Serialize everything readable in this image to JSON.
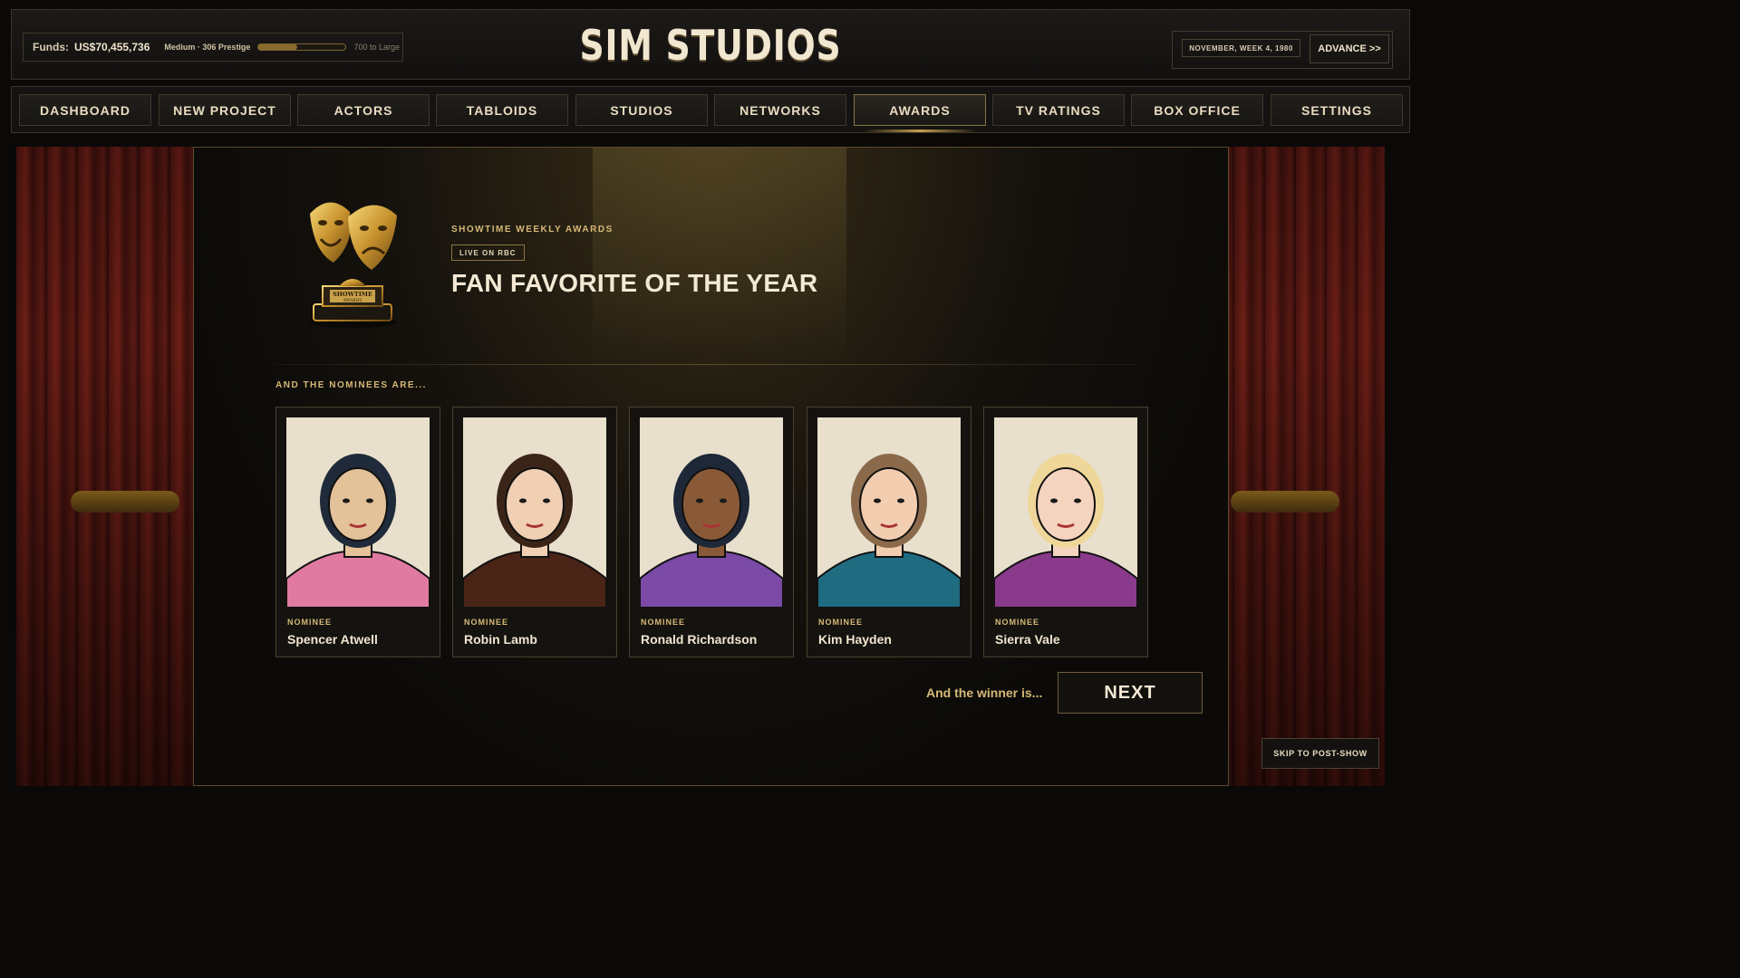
{
  "header": {
    "funds_label": "Funds:",
    "funds_value": "US$70,455,736",
    "studio_tier": "Medium · 306 Prestige",
    "tier_progress": 0.44,
    "next_tier": "700 to Large",
    "logo": "SIM STUDIOS",
    "date": "NOVEMBER, WEEK 4, 1980",
    "advance_label": "ADVANCE >>"
  },
  "nav": {
    "tabs": [
      {
        "label": "DASHBOARD"
      },
      {
        "label": "NEW PROJECT"
      },
      {
        "label": "ACTORS"
      },
      {
        "label": "TABLOIDS"
      },
      {
        "label": "STUDIOS"
      },
      {
        "label": "NETWORKS"
      },
      {
        "label": "AWARDS",
        "active": true
      },
      {
        "label": "TV RATINGS"
      },
      {
        "label": "BOX OFFICE"
      },
      {
        "label": "SETTINGS"
      }
    ]
  },
  "awards": {
    "event": "SHOWTIME WEEKLY AWARDS",
    "broadcast": "LIVE ON RBC",
    "category": "FAN FAVORITE OF THE YEAR",
    "trophy_plate": "SHOWTIME",
    "trophy_plate_sub": "AWARDS",
    "nominees_heading": "AND THE NOMINEES ARE...",
    "nominee_label": "NOMINEE",
    "nominees": [
      {
        "name": "Spencer Atwell",
        "hair": "#1f2a3a",
        "skin": "#e3c29a",
        "outfit": "#e07aa0"
      },
      {
        "name": "Robin Lamb",
        "hair": "#3a2418",
        "skin": "#f0cfb3",
        "outfit": "#4a2417"
      },
      {
        "name": "Ronald Richardson",
        "hair": "#1e2838",
        "skin": "#8a5a38",
        "outfit": "#7a4aa6"
      },
      {
        "name": "Kim Hayden",
        "hair": "#8a6a4a",
        "skin": "#f2cdb0",
        "outfit": "#1f6b80"
      },
      {
        "name": "Sierra Vale",
        "hair": "#efd79a",
        "skin": "#f4d4be",
        "outfit": "#8a3a8a"
      }
    ],
    "winner_prompt": "And the winner is...",
    "next_label": "NEXT",
    "skip_label": "SKIP TO POST-SHOW"
  },
  "colors": {
    "accent_gold": "#d6b877",
    "curtain_red": "#6e1f16",
    "panel_border": "#5a4a2c"
  }
}
